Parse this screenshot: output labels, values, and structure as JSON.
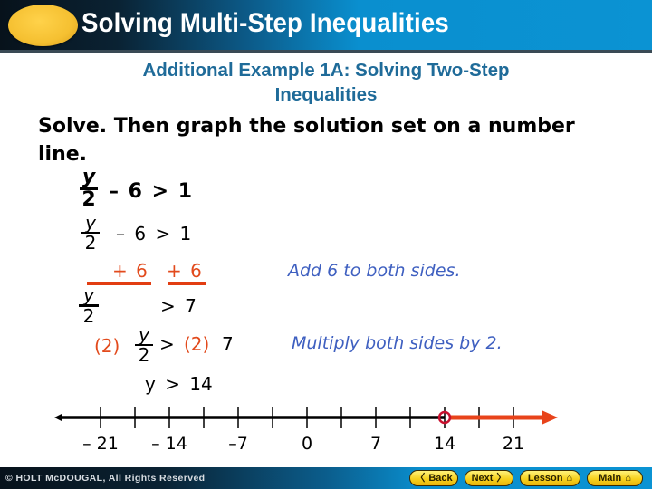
{
  "header": {
    "title": "Solving Multi-Step Inequalities"
  },
  "subtitle": {
    "line1": "Additional Example 1A: Solving Two-Step",
    "line2": "Inequalities"
  },
  "instruction": "Solve. Then graph the solution set on a number line.",
  "problem": {
    "numerator": "y",
    "denominator": "2",
    "rest": "– 6 > 1"
  },
  "steps": {
    "step1": {
      "numerator": "y",
      "denominator": "2",
      "rest": "– 6 > 1"
    },
    "step2": {
      "left_add": "+ 6",
      "right_add": "+ 6",
      "explanation": "Add 6 to both sides."
    },
    "step3": {
      "numerator": "y",
      "denominator": "2",
      "rest": "> 7"
    },
    "step4": {
      "left_factor": "(2)",
      "numerator": "y",
      "denominator": "2",
      "gt": ">",
      "right_factor": "(2)",
      "right_value": "7",
      "explanation": "Multiply both sides by 2."
    },
    "step5": {
      "result": "y > 14"
    }
  },
  "number_line": {
    "min": -21,
    "max": 21,
    "tick_step": 3.5,
    "labels": [
      "– 21",
      "– 14",
      "–7",
      "0",
      "7",
      "14",
      "21"
    ],
    "label_values": [
      -21,
      -14,
      -7,
      0,
      7,
      14,
      21
    ],
    "solution_start": 14,
    "solution_direction": "right",
    "endpoint": "open",
    "colors": {
      "line": "#000000",
      "solution": "#e8431a",
      "circle": "#c8102e"
    }
  },
  "footer": {
    "copyright": "© HOLT McDOUGAL, All Rights Reserved",
    "buttons": [
      {
        "label": "Back",
        "icon": "chevron-left-icon"
      },
      {
        "label": "Next",
        "icon": "chevron-right-icon"
      },
      {
        "label": "Lesson",
        "icon": "home-icon"
      },
      {
        "label": "Main",
        "icon": "home-icon"
      }
    ]
  }
}
